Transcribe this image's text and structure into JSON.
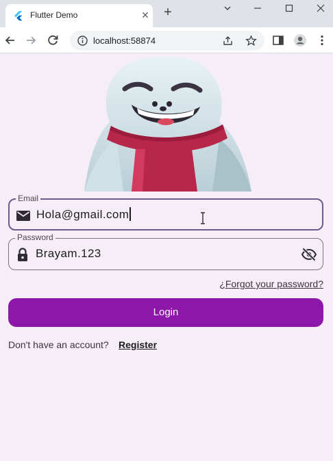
{
  "browser": {
    "tab_title": "Flutter Demo",
    "tab_icon": "flutter-logo-icon",
    "url": "localhost:58874"
  },
  "form": {
    "email": {
      "label": "Email",
      "value": "Hola@gmail.com",
      "icon": "mail-icon"
    },
    "password": {
      "label": "Password",
      "value": "Brayam.123",
      "icon": "lock-icon",
      "toggle_icon": "visibility-off-icon"
    },
    "forgot_label": "¿Forgot your password?",
    "login_label": "Login",
    "no_account_text": "Don't have an account?",
    "register_label": "Register"
  },
  "colors": {
    "background": "#f6eef6",
    "primary": "#8d17a8",
    "focused_border": "#6b5a8e"
  }
}
